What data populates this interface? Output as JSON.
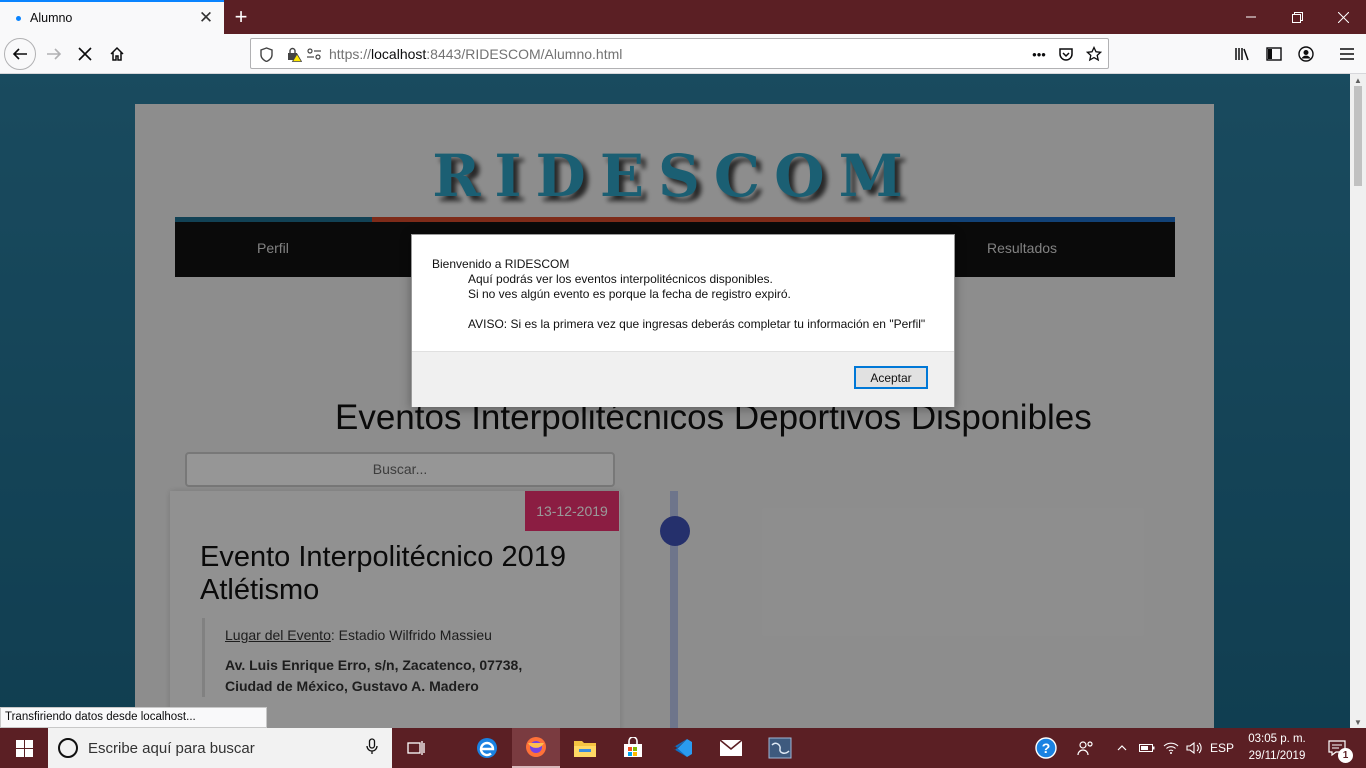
{
  "browser": {
    "tab_title": "Alumno",
    "new_tab": "+",
    "url_prefix": "https://",
    "url_host": "localhost",
    "url_rest": ":8443/RIDESCOM/Alumno.html",
    "url_more": "•••",
    "status_text": "Transfiriendo datos desde localhost..."
  },
  "page": {
    "logo": "RIDESCOM",
    "menu": [
      "Perfil",
      "Resultados"
    ],
    "heading": "Eventos Interpolitécnicos Deportivos Disponibles",
    "search_placeholder": "Buscar...",
    "event": {
      "date": "13-12-2019",
      "title": "Evento Interpolitécnico 2019 Atlétismo",
      "place_label": "Lugar del Evento",
      "place_value": ": Estadio Wilfrido Massieu",
      "address_line1": "Av. Luis Enrique Erro, s/n, Zacatenco, 07738,",
      "address_line2": "Ciudad de México, Gustavo A. Madero"
    }
  },
  "dialog": {
    "line1": "Bienvenido a RIDESCOM",
    "line2": "Aquí podrás ver los eventos interpolitécnicos disponibles.",
    "line3": "Si no ves algún evento es porque la fecha de registro expiró.",
    "line4": "AVISO: Si es la primera vez que ingresas deberás completar tu información en \"Perfil\"",
    "ok_label": "Aceptar"
  },
  "taskbar": {
    "search_placeholder": "Escribe aquí para buscar",
    "language": "ESP",
    "time": "03:05 p. m.",
    "date": "29/11/2019",
    "notification_count": "1"
  },
  "colors": {
    "accent_bars": [
      "#1e6f8e",
      "#d2492a",
      "#1f6fc6"
    ],
    "date_badge": "#e8316f",
    "timeline_dot": "#3f51b5"
  }
}
